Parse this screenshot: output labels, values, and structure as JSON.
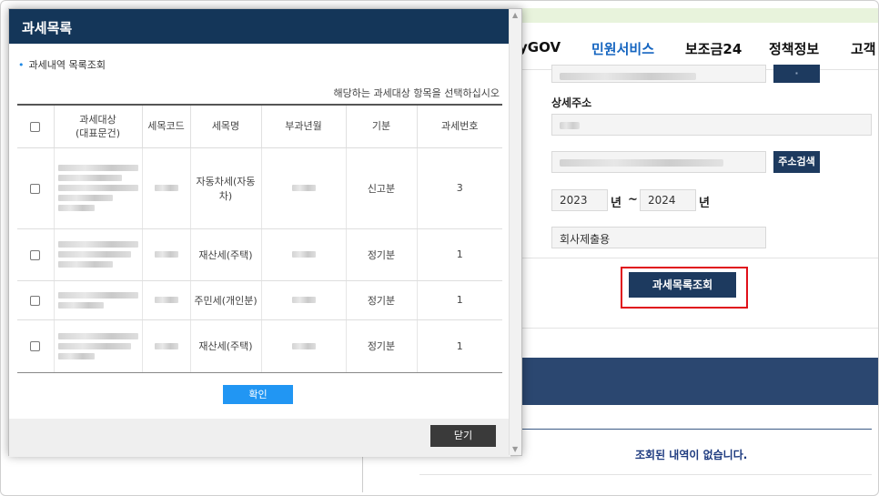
{
  "background": {
    "nav": {
      "items": [
        "yGOV",
        "민원서비스",
        "보조금24",
        "정책정보",
        "고객"
      ],
      "active_index": 1
    },
    "address_search_label": "주소검색",
    "detail_address_label": "상세주소",
    "year_from": "2023",
    "year_unit": "년",
    "tilde": "~",
    "year_to": "2024",
    "purpose_value": "회사제출용",
    "query_button": "과세목록조회",
    "no_result": "조회된 내역이 없습니다."
  },
  "modal": {
    "title": "과세목록",
    "section_title": "과세내역 목록조회",
    "guide": "해당하는 과세대상 항목을 선택하십시오",
    "columns": [
      "",
      "과세대상\n(대표문건)",
      "세목코드",
      "세목명",
      "부과년월",
      "기분",
      "과세번호"
    ],
    "rows": [
      {
        "tax_name": "자동차세(자동차)",
        "period_type": "신고분",
        "tax_no": "3"
      },
      {
        "tax_name": "재산세(주택)",
        "period_type": "정기분",
        "tax_no": "1"
      },
      {
        "tax_name": "주민세(개인분)",
        "period_type": "정기분",
        "tax_no": "1"
      },
      {
        "tax_name": "재산세(주택)",
        "period_type": "정기분",
        "tax_no": "1"
      }
    ],
    "confirm_button": "확인",
    "close_button": "닫기"
  },
  "colors": {
    "modal_header": "#143659",
    "navy_button": "#1d3a5f",
    "confirm_button": "#2196f3",
    "highlight_box": "#e0101a",
    "active_nav": "#1565c0"
  }
}
